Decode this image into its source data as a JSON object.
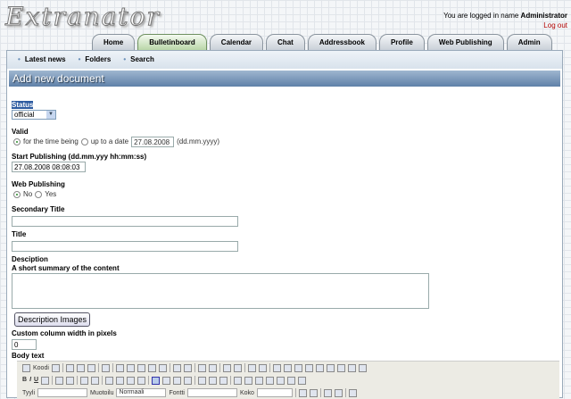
{
  "app": {
    "logo": "Extranator",
    "logged_in_text": "You are logged in name",
    "user": "Administrator",
    "logout": "Log out"
  },
  "tabs": [
    "Home",
    "Bulletinboard",
    "Calendar",
    "Chat",
    "Addressbook",
    "Profile",
    "Web Publishing",
    "Admin"
  ],
  "active_tab": "Bulletinboard",
  "subnav": [
    "Latest news",
    "Folders",
    "Search"
  ],
  "page_title": "Add new document",
  "form": {
    "status_label": "Status",
    "status_value": "official",
    "valid_label": "Valid",
    "valid_opt1": "for the time being",
    "valid_opt2": "up to a date",
    "valid_date": "27.08.2008",
    "valid_hint": "(dd.mm.yyyy)",
    "start_label": "Start Publishing (dd.mm.yyy hh:mm:ss)",
    "start_value": "27.08.2008 08:08:03",
    "web_label": "Web Publishing",
    "web_no": "No",
    "web_yes": "Yes",
    "secondary_title_label": "Secondary Title",
    "secondary_title_value": "",
    "title_label": "Title",
    "title_value": "",
    "description_label": "Desciption",
    "description_sub": "A short summary of the content",
    "description_value": "",
    "desc_images_button": "Description Images",
    "column_width_label": "Custom column width in pixels",
    "column_width_value": "0",
    "body_label": "Body text"
  },
  "editor": {
    "source_button": "Koodi",
    "style_label": "Tyyli",
    "style_value": "",
    "format_label": "Muotoilu",
    "format_value": "Normaali",
    "font_label": "Fontti",
    "font_value": "",
    "size_label": "Koko",
    "size_value": "",
    "bold": "B",
    "italic": "I",
    "underline": "U"
  }
}
